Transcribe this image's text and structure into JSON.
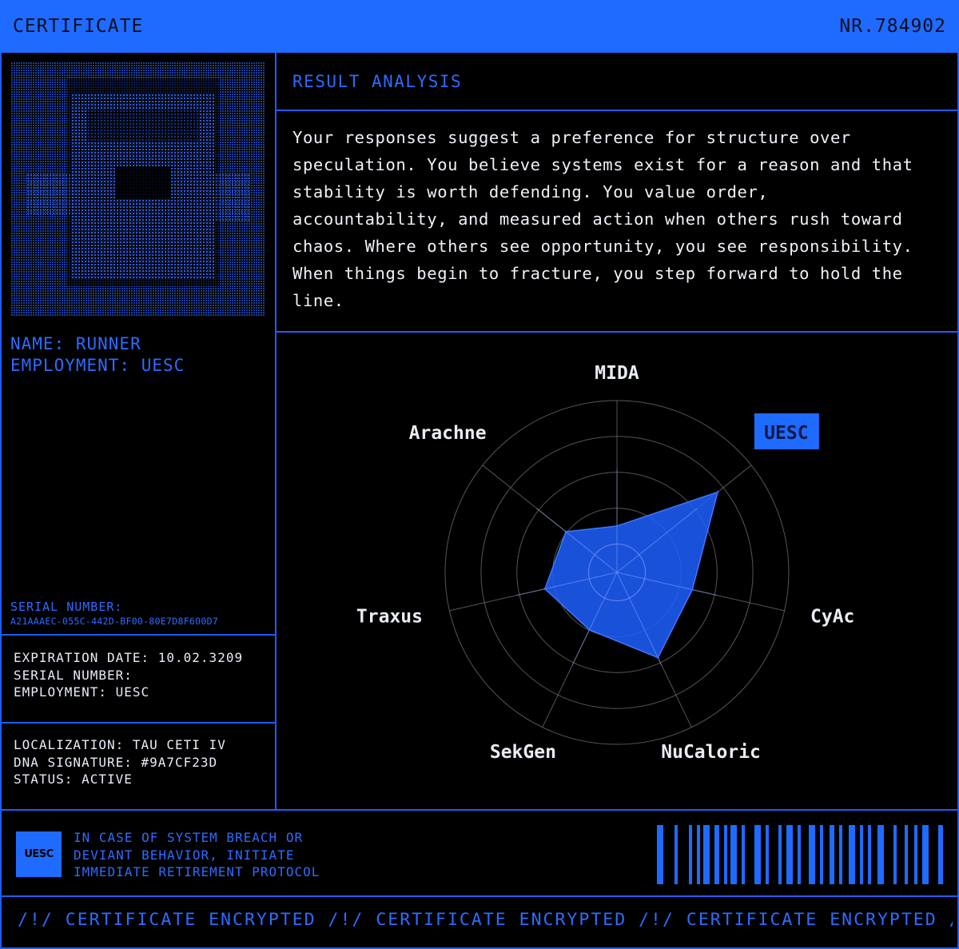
{
  "header": {
    "title": "CERTIFICATE",
    "number": "NR.784902"
  },
  "profile": {
    "name_line": "NAME: RUNNER",
    "employment_line": "EMPLOYMENT: UESC",
    "serial_label": "SERIAL NUMBER:",
    "serial_value": "A21AAAEC-055C-442D-BF00-80E7D8F600D7"
  },
  "details": {
    "expiration": "EXPIRATION DATE: 10.02.3209",
    "serial": "SERIAL NUMBER:",
    "employment": "EMPLOYMENT: UESC"
  },
  "status": {
    "localization": "LOCALIZATION: TAU CETI IV",
    "dna": "DNA SIGNATURE: #9A7CF23D",
    "state": "STATUS: ACTIVE"
  },
  "analysis": {
    "title": "RESULT ANALYSIS",
    "text": "Your responses suggest a preference for structure over speculation. You believe systems exist for a reason and that stability is worth defending. You value order, accountability, and measured action when others rush toward chaos. Where others see opportunity, you see responsibility. When things begin to fracture, you step forward to hold the line."
  },
  "chart_data": {
    "type": "radar",
    "axes": [
      "MIDA",
      "UESC",
      "CyAc",
      "NuCaloric",
      "SekGen",
      "Traxus",
      "Arachne"
    ],
    "values": [
      0.27,
      0.75,
      0.45,
      0.55,
      0.37,
      0.43,
      0.38
    ],
    "rings": 5,
    "highlight": "UESC",
    "accent": "#1f5fff"
  },
  "footer": {
    "logo": "UESC",
    "warning": [
      "IN CASE OF SYSTEM BREACH OR",
      "DEVIANT BEHAVIOR, INITIATE",
      "IMMEDIATE RETIREMENT PROTOCOL"
    ],
    "ticker": "/!/ CERTIFICATE ENCRYPTED /!/ CERTIFICATE ENCRYPTED /!/ CERTIFICATE ENCRYPTED /!/ CE"
  },
  "colors": {
    "accent": "#1f6bff",
    "background": "#000000",
    "text": "#eef1f8"
  }
}
